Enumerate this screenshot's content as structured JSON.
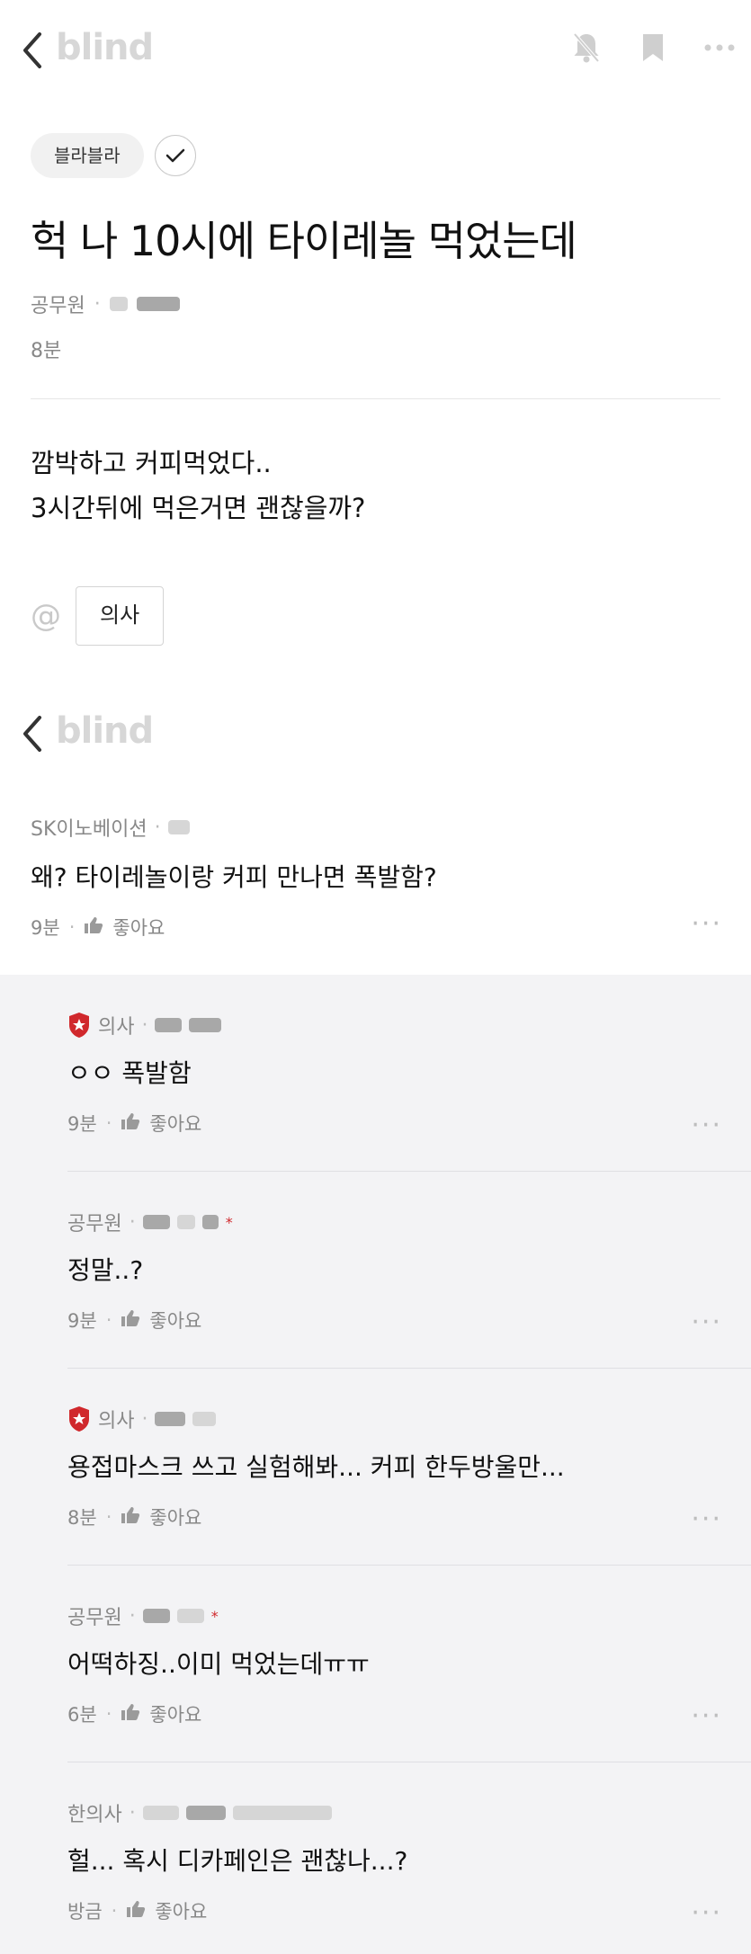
{
  "app": {
    "logo_text": "blind"
  },
  "post": {
    "channel": "블라블라",
    "title": "헉 나 10시에 타이레놀 먹었는데",
    "author_company": "공무원",
    "time": "8분",
    "body_lines": [
      "깜박하고 커피먹었다..",
      "3시간뒤에 먹은거면 괜찮을까?"
    ],
    "mention_tag": "의사",
    "at_symbol": "@"
  },
  "comment": {
    "author_company": "SK이노베이션",
    "text": "왜? 타이레놀이랑 커피 만나면 폭발함?",
    "time": "9분",
    "like_label": "좋아요",
    "more": "···"
  },
  "replies": [
    {
      "author_company": "의사",
      "doctor_badge": true,
      "verified_star": false,
      "text": "ㅇㅇ 폭발함",
      "time": "9분",
      "like_label": "좋아요"
    },
    {
      "author_company": "공무원",
      "doctor_badge": false,
      "verified_star": true,
      "text": "정말..?",
      "time": "9분",
      "like_label": "좋아요"
    },
    {
      "author_company": "의사",
      "doctor_badge": true,
      "verified_star": false,
      "text": "용접마스크 쓰고 실험해봐... 커피 한두방울만...",
      "time": "8분",
      "like_label": "좋아요"
    },
    {
      "author_company": "공무원",
      "doctor_badge": false,
      "verified_star": true,
      "text": "어떡하징..이미 먹었는데ㅠㅠ",
      "time": "6분",
      "like_label": "좋아요"
    },
    {
      "author_company": "한의사",
      "doctor_badge": false,
      "verified_star": false,
      "text": "헐... 혹시 디카페인은 괜찮나...?",
      "time": "방금",
      "like_label": "좋아요"
    }
  ],
  "colors": {
    "accent_red": "#d0282c",
    "reply_bg": "#f3f3f5",
    "logo_gray": "#d7d7d7"
  },
  "icons": [
    "back-chevron-icon",
    "bell-off-icon",
    "bookmark-icon",
    "more-icon",
    "check-icon",
    "at-icon",
    "thumbs-up-icon",
    "doctor-badge-icon"
  ]
}
